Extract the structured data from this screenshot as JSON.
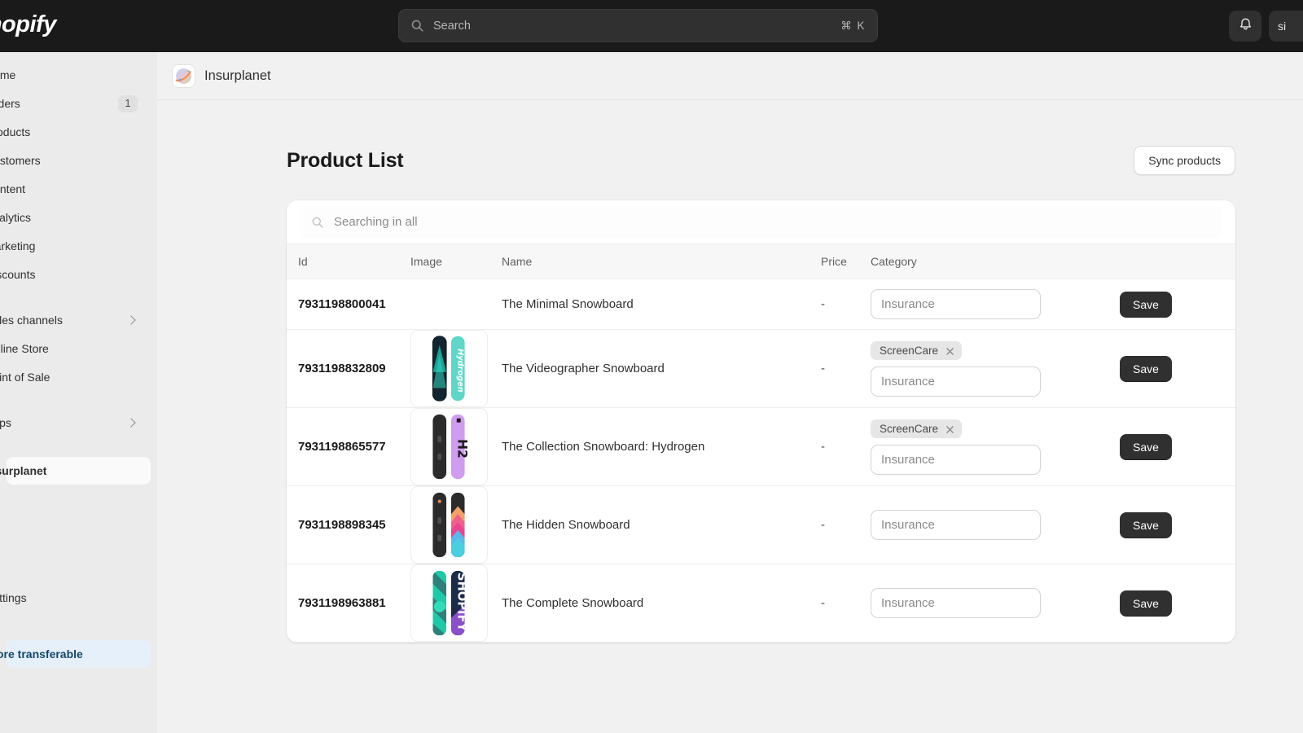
{
  "topbar": {
    "brand": "Shopify",
    "search_placeholder": "Search",
    "search_shortcut": "⌘ K",
    "notifications_icon": "bell-icon",
    "account_label": "si"
  },
  "sidebar": {
    "items": [
      {
        "label": "Home",
        "badge": null,
        "chevron": false
      },
      {
        "label": "Orders",
        "badge": "1",
        "chevron": false
      },
      {
        "label": "Products",
        "badge": null,
        "chevron": false
      },
      {
        "label": "Customers",
        "badge": null,
        "chevron": false
      },
      {
        "label": "Content",
        "badge": null,
        "chevron": false
      },
      {
        "label": "Analytics",
        "badge": null,
        "chevron": false
      },
      {
        "label": "Marketing",
        "badge": null,
        "chevron": false
      },
      {
        "label": "Discounts",
        "badge": null,
        "chevron": false
      }
    ],
    "channels": [
      {
        "label": "Sales channels",
        "badge": null,
        "chevron": true
      },
      {
        "label": "Online Store",
        "badge": null,
        "chevron": false
      },
      {
        "label": "Point of Sale",
        "badge": null,
        "chevron": false
      }
    ],
    "apps": [
      {
        "label": "Apps",
        "badge": null,
        "chevron": true
      },
      {
        "label": "Insurplanet",
        "badge": null,
        "chevron": false,
        "active": true
      }
    ],
    "footer": [
      {
        "label": "Settings",
        "badge": null,
        "chevron": false
      },
      {
        "label": "Store transferable",
        "badge": null,
        "chevron": false,
        "highlight": true
      }
    ]
  },
  "app": {
    "icon": "planet-icon",
    "name": "Insurplanet"
  },
  "page": {
    "title": "Product List",
    "sync_button": "Sync products"
  },
  "table_search": {
    "icon": "search-icon",
    "placeholder": "Searching in all"
  },
  "table": {
    "columns": [
      "Id",
      "Image",
      "Name",
      "Price",
      "Category",
      ""
    ],
    "rows": [
      {
        "id": "7931198800041",
        "image": null,
        "name": "The Minimal Snowboard",
        "price": "-",
        "chips": [],
        "category_placeholder": "Insurance",
        "category_value": "",
        "save_label": "Save"
      },
      {
        "id": "7931198832809",
        "image": "snowboard-hydrogen-teal",
        "name": "The Videographer Snowboard",
        "price": "-",
        "chips": [
          "ScreenCare"
        ],
        "category_placeholder": "Insurance",
        "category_value": "",
        "save_label": "Save"
      },
      {
        "id": "7931198865577",
        "image": "snowboard-black-lilac",
        "name": "The Collection Snowboard: Hydrogen",
        "price": "-",
        "chips": [
          "ScreenCare"
        ],
        "category_placeholder": "Insurance",
        "category_value": "",
        "save_label": "Save"
      },
      {
        "id": "7931198898345",
        "image": "snowboard-black-gradient",
        "name": "The Hidden Snowboard",
        "price": "-",
        "chips": [],
        "category_placeholder": "Insurance",
        "category_value": "",
        "save_label": "Save"
      },
      {
        "id": "7931198963881",
        "image": "snowboard-teal-shopify",
        "name": "The Complete Snowboard",
        "price": "-",
        "chips": [],
        "category_placeholder": "Insurance",
        "category_value": "",
        "save_label": "Save"
      }
    ]
  },
  "colors": {
    "topbar_bg": "#1a1a1a",
    "sidebar_bg": "#ebebeb",
    "canvas_bg": "#f1f1f1",
    "card_bg": "#ffffff",
    "save_btn": "#303030",
    "chip_bg": "#e6e6e6",
    "highlight_bg": "#e6f0fb",
    "highlight_text": "#14486b"
  }
}
